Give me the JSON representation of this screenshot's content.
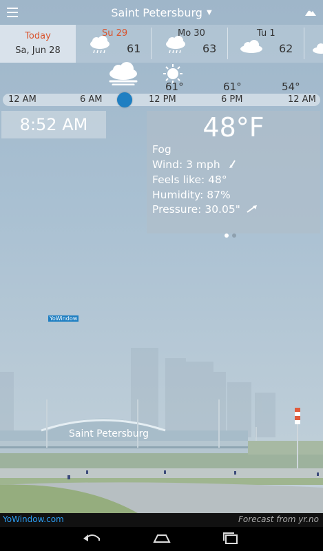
{
  "header": {
    "city": "Saint Petersburg"
  },
  "days": {
    "today": {
      "label": "Today",
      "date": "Sa, Jun 28"
    },
    "items": [
      {
        "name": "Su 29",
        "temp": "61",
        "icon": "rain-cloud-icon",
        "highlight": true
      },
      {
        "name": "Mo 30",
        "temp": "63",
        "icon": "rain-cloud-icon",
        "highlight": false
      },
      {
        "name": "Tu 1",
        "temp": "62",
        "icon": "cloud-icon",
        "highlight": false
      }
    ]
  },
  "hourly": {
    "temps": [
      "61°",
      "61°",
      "54°"
    ]
  },
  "timeline": {
    "ticks": [
      "12 AM",
      "6 AM",
      "12 PM",
      "6 PM",
      "12 AM"
    ]
  },
  "clock": {
    "time": "8:52 AM"
  },
  "current": {
    "temp": "48°F",
    "condition": "Fog",
    "wind": "Wind:  3 mph",
    "feels": "Feels like: 48°",
    "humidity": "Humidity:  87%",
    "pressure": "Pressure: 30.05\""
  },
  "scene": {
    "badge": "YoWindow",
    "city_label": "Saint Petersburg"
  },
  "footer": {
    "left": "YoWindow.com",
    "right": "Forecast from yr.no"
  },
  "colors": {
    "accent": "#1f7fc2",
    "today_red": "#d9532d"
  }
}
